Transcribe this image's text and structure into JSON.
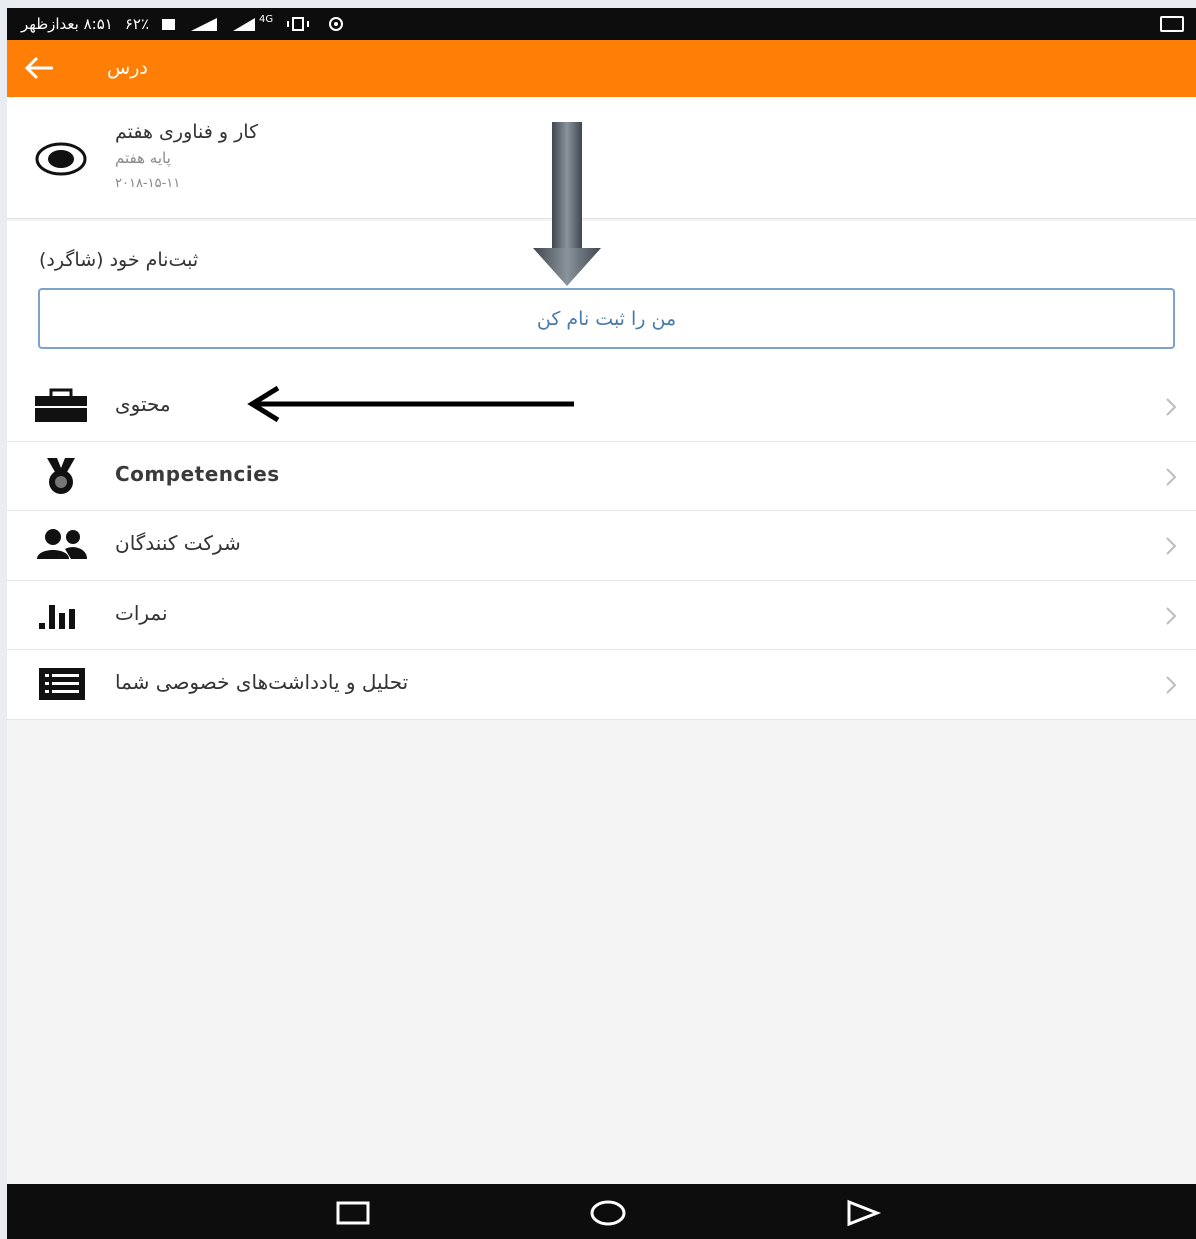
{
  "status_bar": {
    "time": "۸:۵۱ بعدازظهر",
    "battery": "۶۲٪",
    "network": "4G"
  },
  "app_bar": {
    "title": "درس"
  },
  "course": {
    "title": "کار و فناوری هفتم",
    "subtitle": "پایه هفتم",
    "date": "۲۰۱۸-۱۵-۱۱"
  },
  "enrol": {
    "label": "(ثبت‌نام خود (شاگرد",
    "button_label": "من را ثبت نام کن"
  },
  "menu": {
    "items": [
      {
        "label": "محتوی",
        "icon": "briefcase-icon"
      },
      {
        "label": "Competencies",
        "icon": "medal-icon"
      },
      {
        "label": "شرکت کنندگان",
        "icon": "participants-icon"
      },
      {
        "label": "نمرات",
        "icon": "grades-chart-icon"
      },
      {
        "label": "تحلیل و یادداشت‌های خصوصی شما",
        "icon": "notes-list-icon"
      }
    ]
  },
  "colors": {
    "app_bar": "#ff7f06",
    "button_border": "#7ba3cc",
    "button_text": "#4a7aa8",
    "annotation_arrow_gray": "#5d6670"
  }
}
